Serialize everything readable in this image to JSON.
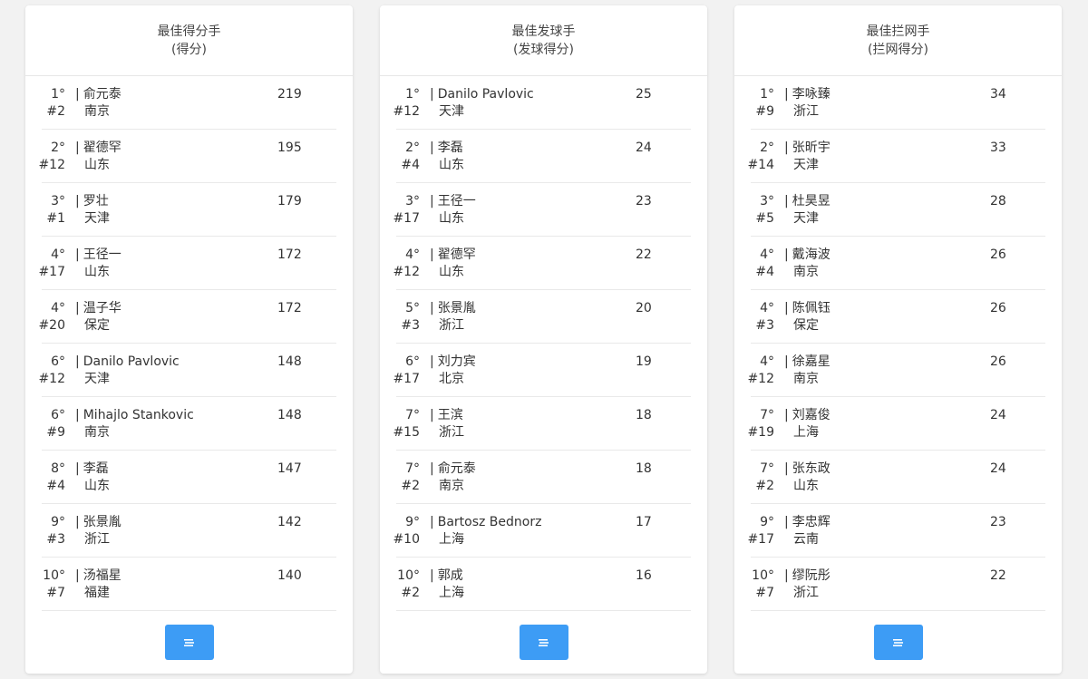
{
  "colors": {
    "accent": "#3d9cf5",
    "background": "#f2f2f2",
    "card": "#ffffff"
  },
  "cards": [
    {
      "title": "最佳得分手",
      "subtitle": "(得分)",
      "button_icon": "menu-lines-icon",
      "rows": [
        {
          "rank": "1°",
          "num": "#2",
          "name": "俞元泰",
          "team": "南京",
          "value": "219"
        },
        {
          "rank": "2°",
          "num": "#12",
          "name": "翟德罕",
          "team": "山东",
          "value": "195"
        },
        {
          "rank": "3°",
          "num": "#1",
          "name": "罗壮",
          "team": "天津",
          "value": "179"
        },
        {
          "rank": "4°",
          "num": "#17",
          "name": "王径一",
          "team": "山东",
          "value": "172"
        },
        {
          "rank": "4°",
          "num": "#20",
          "name": "温子华",
          "team": "保定",
          "value": "172"
        },
        {
          "rank": "6°",
          "num": "#12",
          "name": "Danilo Pavlovic",
          "team": "天津",
          "value": "148"
        },
        {
          "rank": "6°",
          "num": "#9",
          "name": "Mihajlo Stankovic",
          "team": "南京",
          "value": "148"
        },
        {
          "rank": "8°",
          "num": "#4",
          "name": "李磊",
          "team": "山东",
          "value": "147"
        },
        {
          "rank": "9°",
          "num": "#3",
          "name": "张景胤",
          "team": "浙江",
          "value": "142"
        },
        {
          "rank": "10°",
          "num": "#7",
          "name": "汤福星",
          "team": "福建",
          "value": "140"
        }
      ]
    },
    {
      "title": "最佳发球手",
      "subtitle": "(发球得分)",
      "button_icon": "menu-lines-icon",
      "rows": [
        {
          "rank": "1°",
          "num": "#12",
          "name": "Danilo Pavlovic",
          "team": "天津",
          "value": "25"
        },
        {
          "rank": "2°",
          "num": "#4",
          "name": "李磊",
          "team": "山东",
          "value": "24"
        },
        {
          "rank": "3°",
          "num": "#17",
          "name": "王径一",
          "team": "山东",
          "value": "23"
        },
        {
          "rank": "4°",
          "num": "#12",
          "name": "翟德罕",
          "team": "山东",
          "value": "22"
        },
        {
          "rank": "5°",
          "num": "#3",
          "name": "张景胤",
          "team": "浙江",
          "value": "20"
        },
        {
          "rank": "6°",
          "num": "#17",
          "name": "刘力宾",
          "team": "北京",
          "value": "19"
        },
        {
          "rank": "7°",
          "num": "#15",
          "name": "王滨",
          "team": "浙江",
          "value": "18"
        },
        {
          "rank": "7°",
          "num": "#2",
          "name": "俞元泰",
          "team": "南京",
          "value": "18"
        },
        {
          "rank": "9°",
          "num": "#10",
          "name": "Bartosz Bednorz",
          "team": "上海",
          "value": "17"
        },
        {
          "rank": "10°",
          "num": "#2",
          "name": "郭成",
          "team": "上海",
          "value": "16"
        }
      ]
    },
    {
      "title": "最佳拦网手",
      "subtitle": "(拦网得分)",
      "button_icon": "menu-lines-icon",
      "rows": [
        {
          "rank": "1°",
          "num": "#9",
          "name": "李咏臻",
          "team": "浙江",
          "value": "34"
        },
        {
          "rank": "2°",
          "num": "#14",
          "name": "张昕宇",
          "team": "天津",
          "value": "33"
        },
        {
          "rank": "3°",
          "num": "#5",
          "name": "杜昊昱",
          "team": "天津",
          "value": "28"
        },
        {
          "rank": "4°",
          "num": "#4",
          "name": "戴海波",
          "team": "南京",
          "value": "26"
        },
        {
          "rank": "4°",
          "num": "#3",
          "name": "陈佩钰",
          "team": "保定",
          "value": "26"
        },
        {
          "rank": "4°",
          "num": "#12",
          "name": "徐嘉星",
          "team": "南京",
          "value": "26"
        },
        {
          "rank": "7°",
          "num": "#19",
          "name": "刘嘉俊",
          "team": "上海",
          "value": "24"
        },
        {
          "rank": "7°",
          "num": "#2",
          "name": "张东政",
          "team": "山东",
          "value": "24"
        },
        {
          "rank": "9°",
          "num": "#17",
          "name": "李忠辉",
          "team": "云南",
          "value": "23"
        },
        {
          "rank": "10°",
          "num": "#7",
          "name": "缪阮彤",
          "team": "浙江",
          "value": "22"
        }
      ]
    }
  ]
}
